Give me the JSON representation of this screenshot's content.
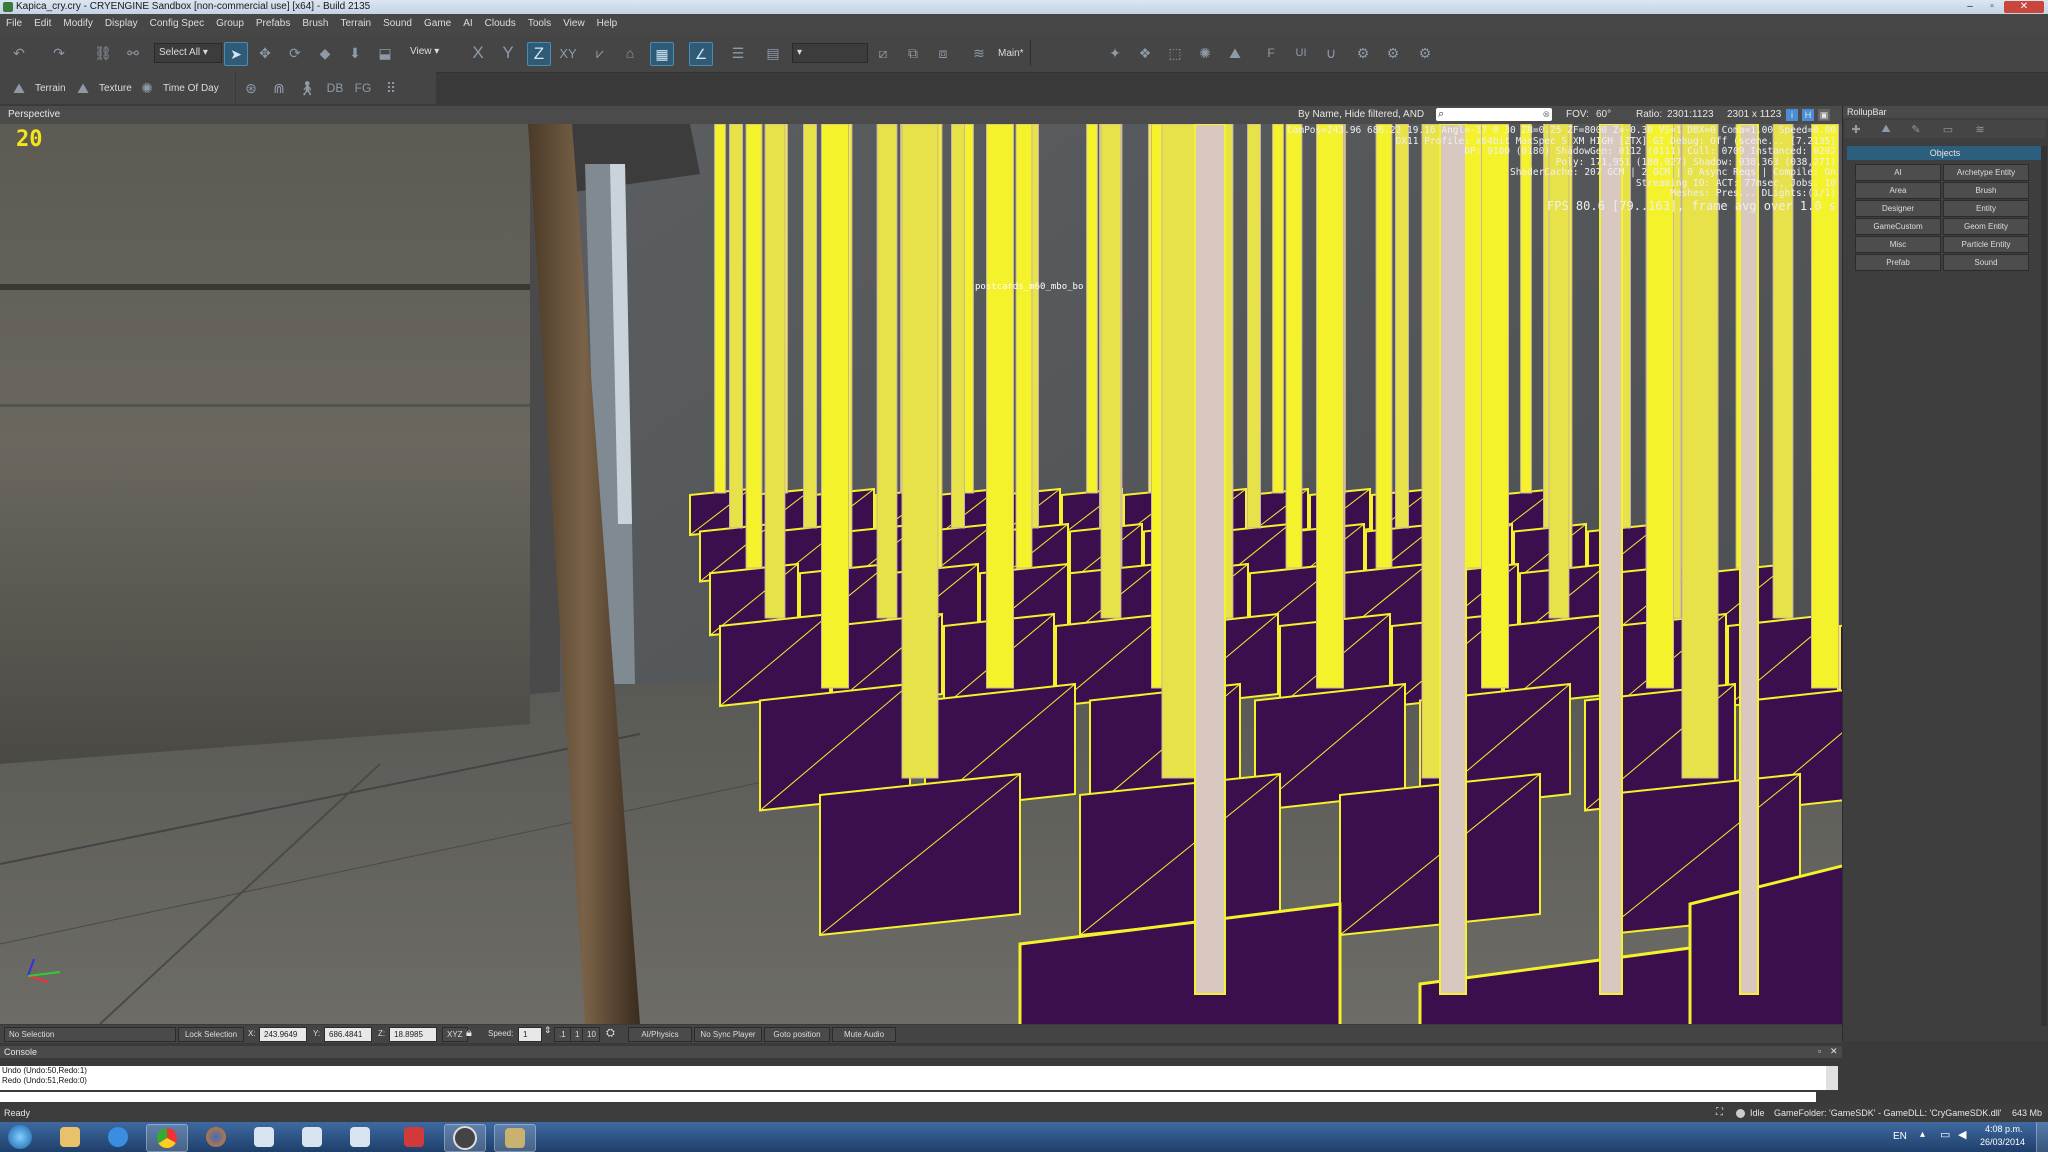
{
  "window": {
    "title": "Kapica_cry.cry - CRYENGINE Sandbox [non-commercial use] [x64] - Build 2135",
    "controls": [
      "–",
      "▫",
      "✕"
    ]
  },
  "menu": [
    "File",
    "Edit",
    "Modify",
    "Display",
    "Config Spec",
    "Group",
    "Prefabs",
    "Brush",
    "Terrain",
    "Sound",
    "Game",
    "AI",
    "Clouds",
    "Tools",
    "View",
    "Help"
  ],
  "toolbar": {
    "select_all": "Select All",
    "view": "View",
    "axes": [
      "X",
      "Y",
      "Z",
      "XY"
    ],
    "layer": "Main*"
  },
  "toolbar2": {
    "terrain": "Terrain",
    "texture": "Texture",
    "time_of_day": "Time Of Day",
    "db": "DB",
    "fg": "FG"
  },
  "viewport": {
    "name": "Perspective",
    "filter": "By Name, Hide filtered, AND",
    "search_value": "",
    "fov_label": "FOV:",
    "fov_value": "60°",
    "ratio_label": "Ratio:",
    "ratio_value": "2301:1123",
    "size_value": "2301 x 1123",
    "fps_counter": "20",
    "object_label": "postcards_m60_mbo_bo",
    "debug_lines": [
      "CamPos=243.96 686.22 19.16 Angl=-17  0  30 ZN=0.25 ZF=8000 Z=-0.30 VS=1 DBX=0 Coma=1.00 Speed=0.00",
      "DX11 Profile: x64bit  MaxSpec S_XM HIGH [ZTX]  GI Debug: Off (scene... [7.2135]",
      "DP: 0180 (0180)  ShadowGen: 0112 (0111)   Cull: 0709  Instanced: 0292",
      "Poly: 171,951 (180,927)  Shadow: 038,363 (038,271)",
      "ShaderCache: 207 GCM | 2 GCM | 0 Async Reqs | Compile: On",
      "Streaming IO: ACT: 77msec, Jobs: 10",
      "Meshes: Pres... DLights:(1/1)",
      "FPS 80.6 [79..163], frame avg over 1.0 s"
    ]
  },
  "rollup": {
    "title": "RollupBar",
    "section": "Objects",
    "buttons": [
      "AI",
      "Archetype Entity",
      "Area",
      "Brush",
      "Designer",
      "Entity",
      "GameCustom",
      "Geom Entity",
      "Misc",
      "Particle Entity",
      "Prefab",
      "Sound"
    ]
  },
  "statusrow": {
    "selection": "No Selection",
    "lock": "Lock Selection",
    "x_label": "X:",
    "x_value": "243.9649",
    "y_label": "Y:",
    "y_value": "686.4841",
    "z_label": "Z:",
    "z_value": "18.8985",
    "xyz": "XYZ",
    "speed_label": "Speed:",
    "speed_value": "1",
    "speed_opts": [
      ".1",
      "1",
      "10"
    ],
    "ai_physics": "AI/Physics",
    "no_sync": "No Sync Player",
    "goto": "Goto position",
    "mute": "Mute Audio"
  },
  "console": {
    "title": "Console",
    "lines": [
      "Undo (Undo:50,Redo:1)",
      "Redo (Undo:51,Redo:0)"
    ]
  },
  "statusbar": {
    "ready": "Ready",
    "idle": "Idle",
    "gamefolder": "GameFolder: 'GameSDK' - GameDLL: 'CryGameSDK.dll'",
    "memory": "643 Mb"
  },
  "taskbar": {
    "lang": "EN",
    "time": "4:08 p.m.",
    "date": "26/03/2014"
  },
  "colors": {
    "accent": "#2f5b77",
    "highlight_yellow": "#f4f22a",
    "panel_purple": "#3b0f4d"
  }
}
